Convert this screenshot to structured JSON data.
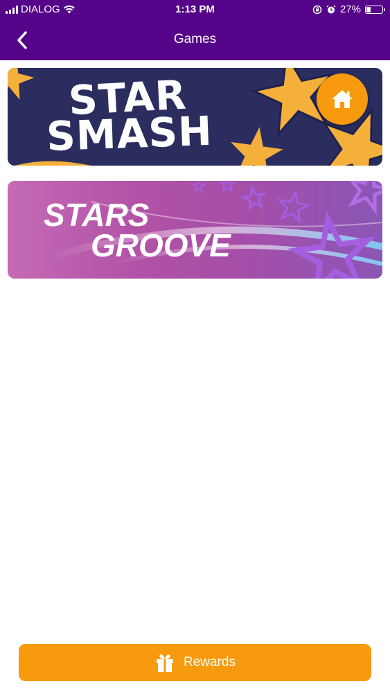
{
  "status_bar": {
    "carrier": "DIALOG",
    "time": "1:13 PM",
    "battery_percent": "27%",
    "battery_level": 0.27
  },
  "nav": {
    "title": "Games",
    "back_icon": "chevron-left-icon"
  },
  "games": [
    {
      "line1": "STAR",
      "line2": "SMASH",
      "background": "#2a2d5e",
      "star_color": "#f4b03a"
    },
    {
      "line1": "STARS",
      "line2": "GROOVE",
      "background": "#b152a6",
      "star_color": "#a45ee0"
    }
  ],
  "home_button": {
    "icon": "home-icon",
    "color": "#f79a0e"
  },
  "rewards_button": {
    "label": "Rewards",
    "icon": "gift-icon",
    "color": "#f79a0e"
  },
  "colors": {
    "header": "#55048a",
    "accent": "#f79a0e"
  }
}
